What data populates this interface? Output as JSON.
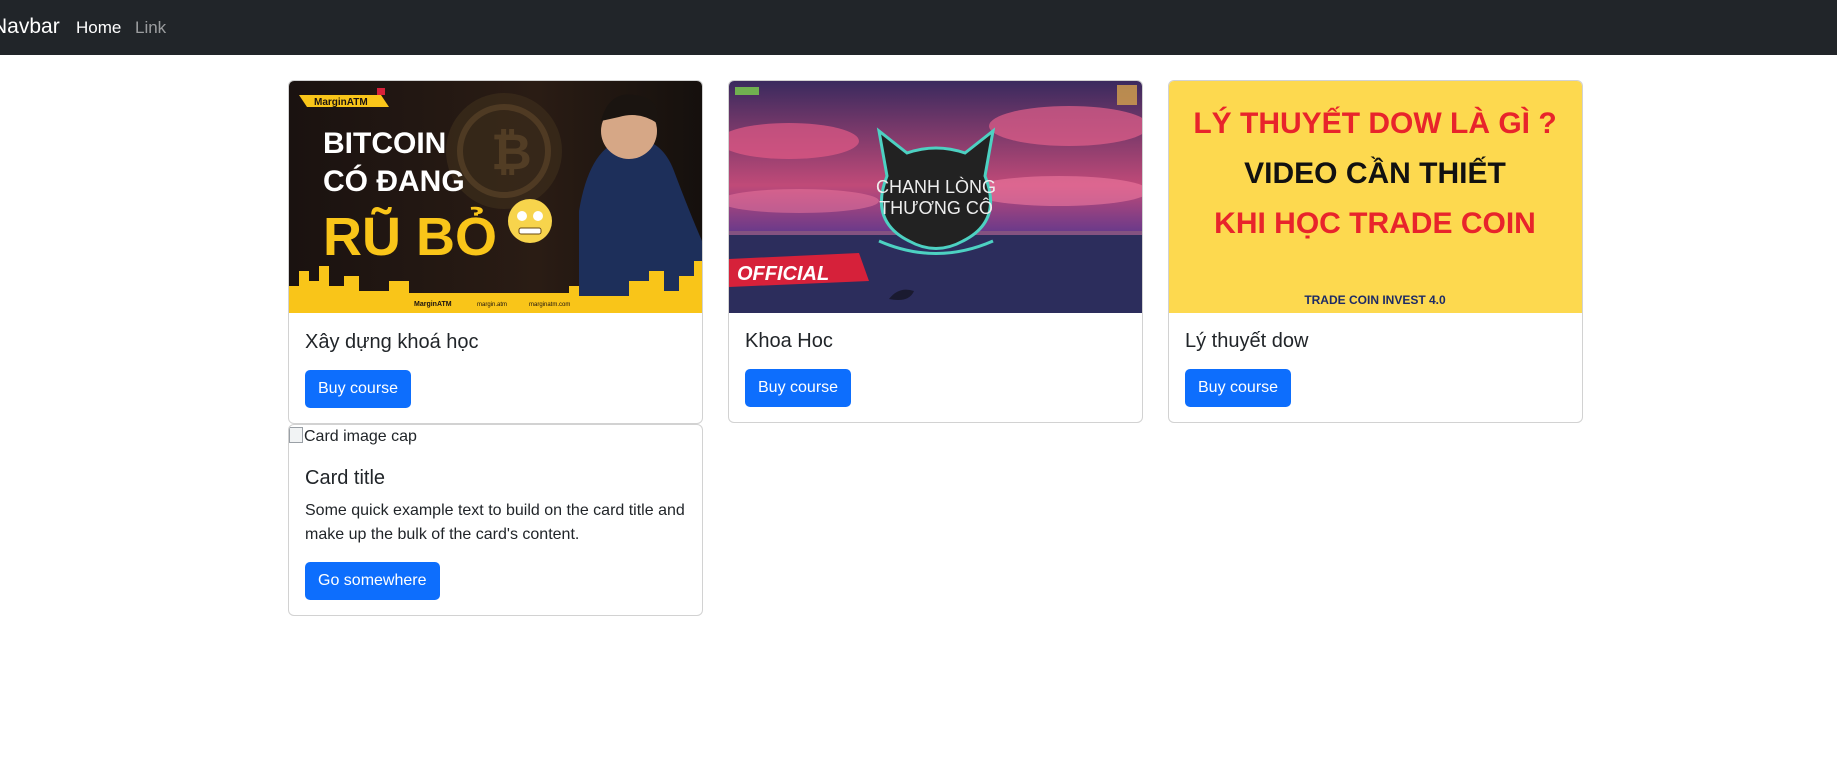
{
  "navbar": {
    "brand": "Navbar",
    "links": [
      {
        "label": "Home",
        "active": true
      },
      {
        "label": "Link",
        "active": false
      }
    ]
  },
  "cards": [
    {
      "title": "Xây dựng khoá học",
      "button": "Buy course",
      "image": {
        "badge": "MarginATM",
        "lines": [
          "BITCOIN",
          "CÓ ĐANG",
          "RŨ BỎ"
        ],
        "footer": [
          "MarginATM",
          "margin.atm",
          "marginatm.com"
        ]
      }
    },
    {
      "title": "Khoa Hoc",
      "button": "Buy course",
      "image": {
        "center_text": [
          "CHANH LÒNG",
          "THƯƠNG CÔ"
        ],
        "ribbon": "OFFICIAL"
      }
    },
    {
      "title": "Lý thuyết dow",
      "button": "Buy course",
      "image": {
        "lines": [
          "LÝ THUYẾT DOW LÀ GÌ ?",
          "VIDEO CẦN THIẾT",
          "KHI HỌC TRADE COIN"
        ],
        "footer": "TRADE COIN INVEST 4.0"
      }
    },
    {
      "title": "Card title",
      "text": "Some quick example text to build on the card title and make up the bulk of the card's content.",
      "button": "Go somewhere",
      "image_alt": "Card image cap"
    }
  ],
  "colors": {
    "navbar_bg": "#212529",
    "primary": "#0d6efd",
    "thumb1_accent": "#f9c519",
    "thumb3_bg": "#fdd94f",
    "thumb3_red": "#e8242b"
  }
}
